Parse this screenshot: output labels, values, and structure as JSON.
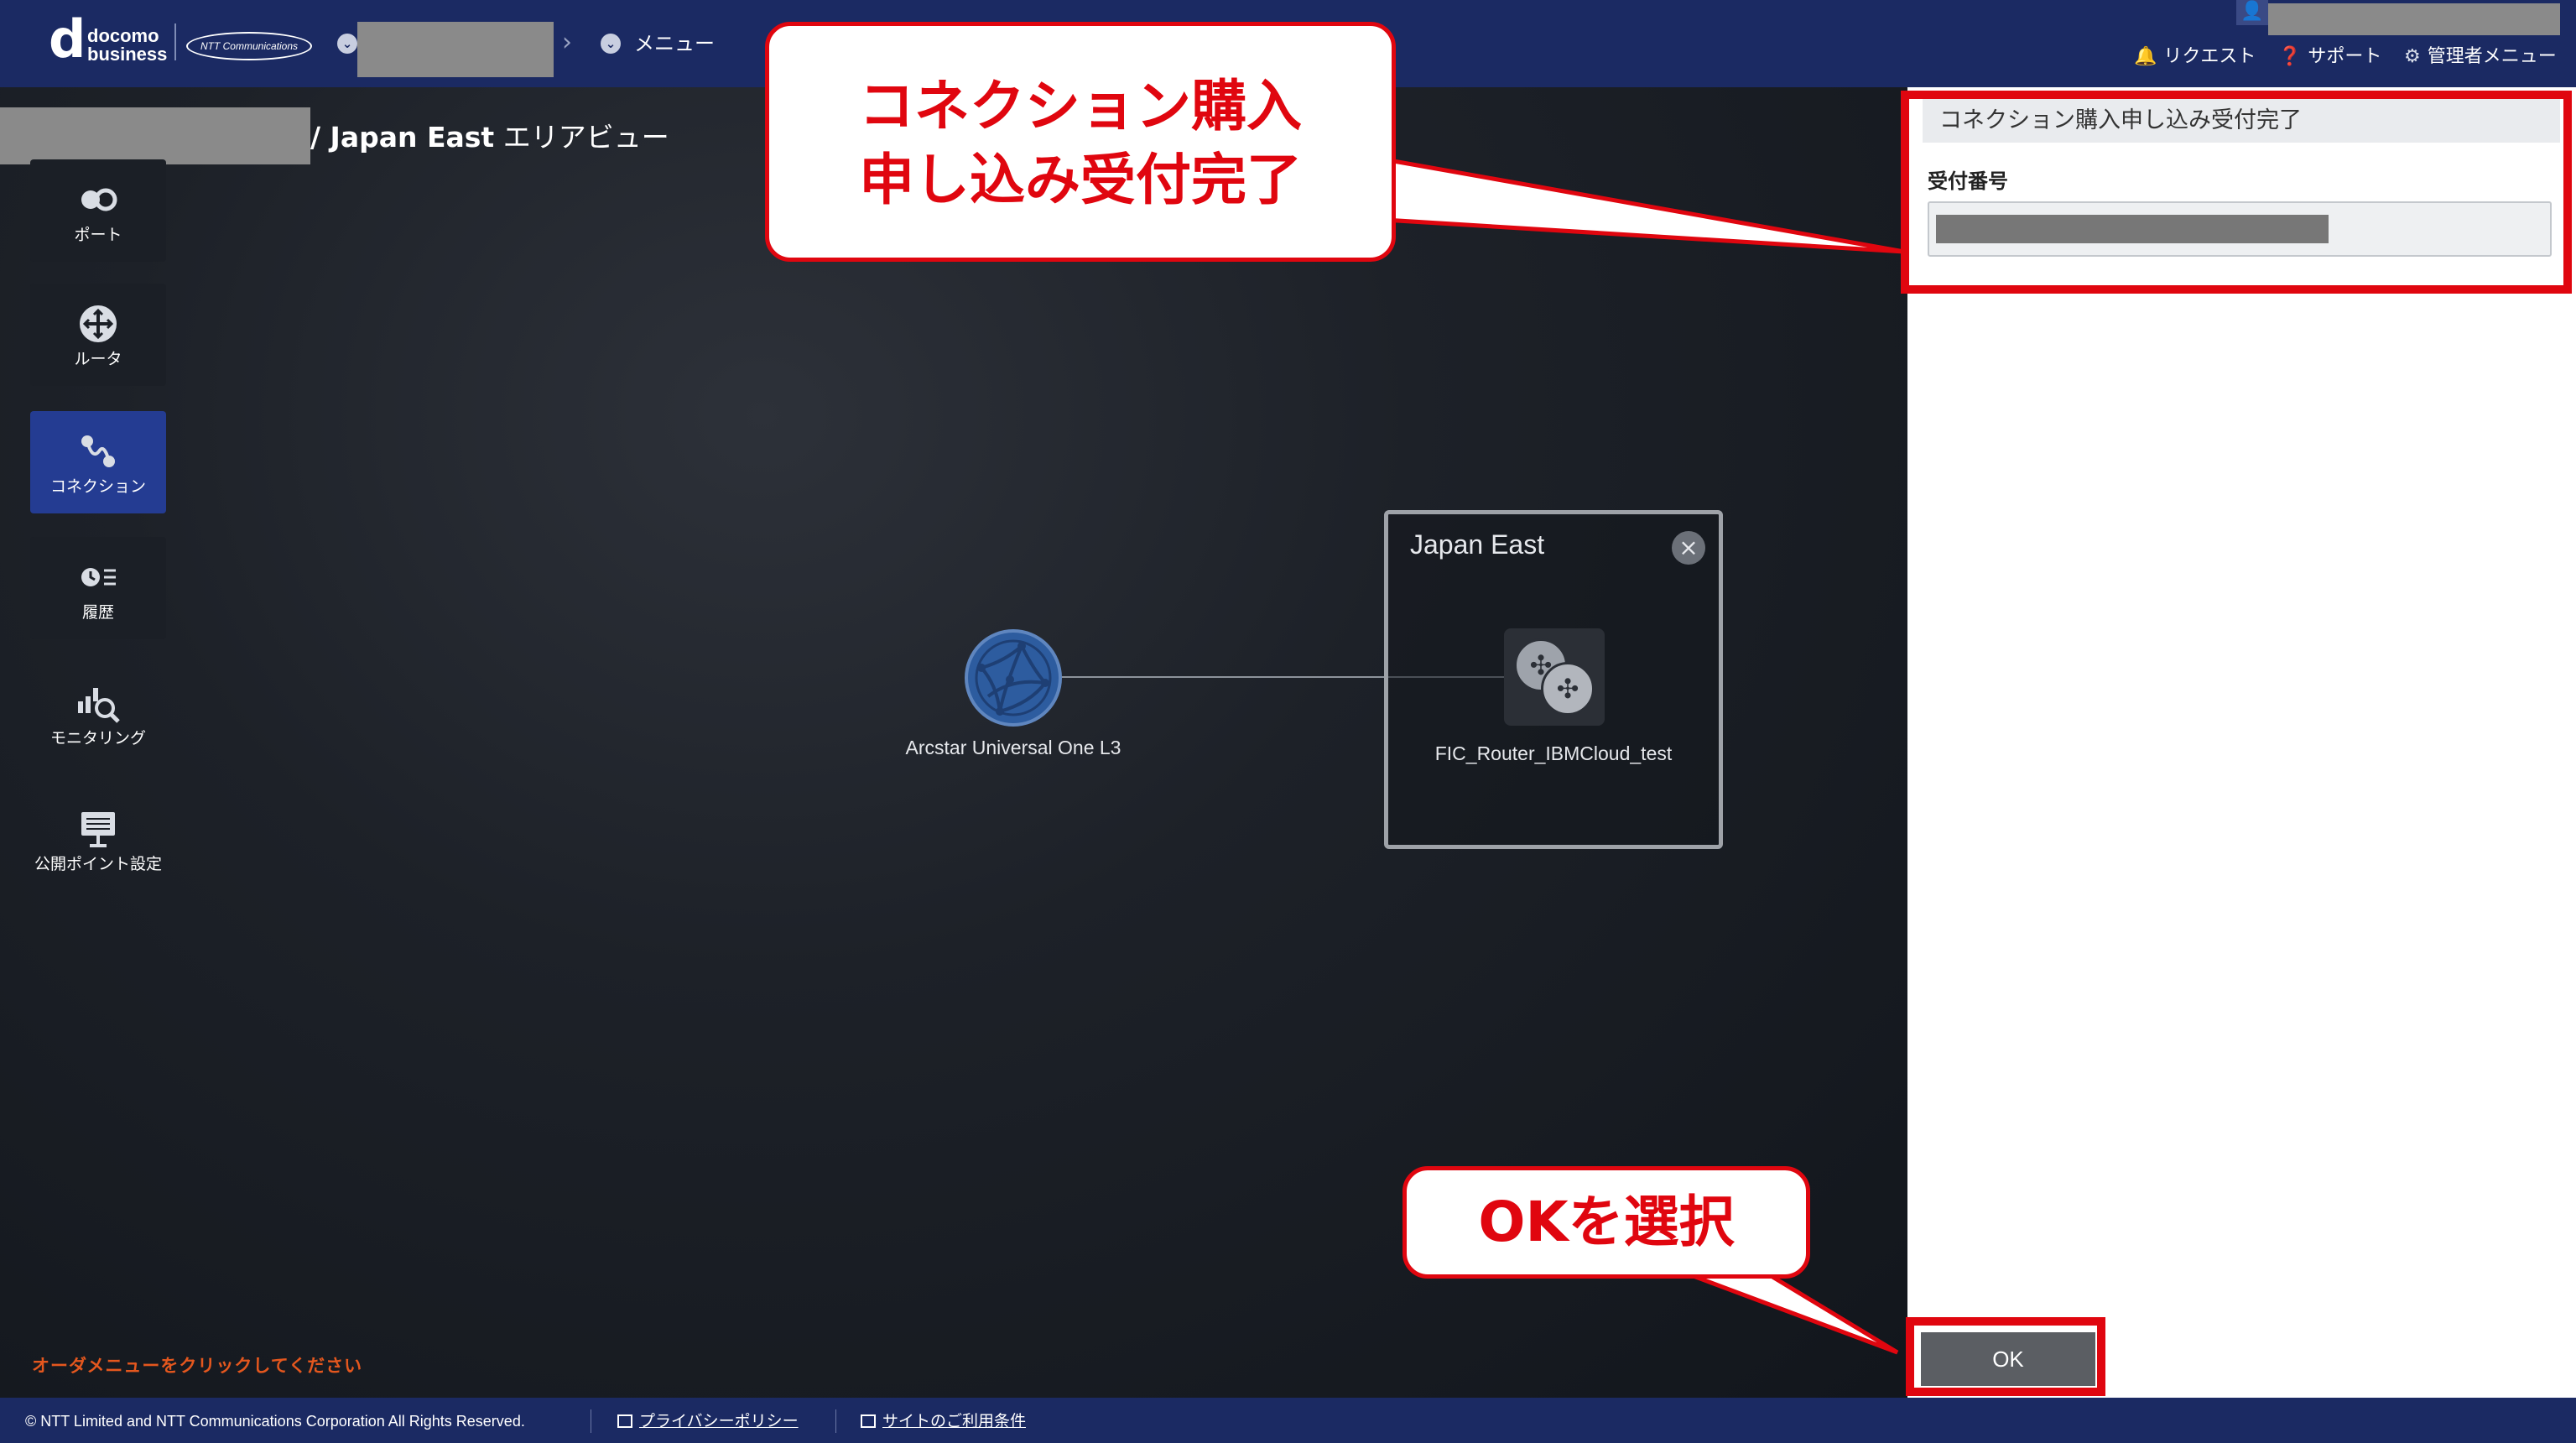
{
  "header": {
    "logo": {
      "mark": "d",
      "line1": "docomo",
      "line2": "business",
      "partner": "NTT Communications"
    },
    "breadcrumb": {
      "menu_label": "メニュー"
    },
    "links": {
      "request": "リクエスト",
      "support": "サポート",
      "admin_menu": "管理者メニュー"
    },
    "icons": [
      "bell-icon",
      "help-icon",
      "gear-icon",
      "user-icon"
    ]
  },
  "page": {
    "heading_bold": "/ Japan East",
    "heading_rest": " エリアビュー"
  },
  "sidebar": {
    "items": [
      {
        "label": "ポート",
        "icon": "port-icon",
        "active": false
      },
      {
        "label": "ルータ",
        "icon": "router-icon",
        "active": false
      },
      {
        "label": "コネクション",
        "icon": "connection-icon",
        "active": true
      },
      {
        "label": "履歴",
        "icon": "history-icon",
        "active": false
      },
      {
        "label": "モニタリング",
        "icon": "monitoring-icon",
        "active": false
      },
      {
        "label": "公開ポイント設定",
        "icon": "public-point-icon",
        "active": false
      }
    ]
  },
  "canvas": {
    "order_hint": "オーダメニューをクリックしてください",
    "arcstar_label": "Arcstar Universal One L3",
    "region_title": "Japan East",
    "router_label": "FIC_Router_IBMCloud_test"
  },
  "panel": {
    "title": "コネクション購入申し込み受付完了",
    "receipt_label": "受付番号",
    "ok_label": "OK"
  },
  "callouts": {
    "completion_line1": "コネクション購入",
    "completion_line2": "申し込み受付完了",
    "select_ok": "OKを選択"
  },
  "footer": {
    "copyright": "© NTT Limited and NTT Communications Corporation All Rights Reserved.",
    "privacy": "プライバシーポリシー",
    "terms": "サイトのご利用条件"
  },
  "colors": {
    "header": "#1b2a63",
    "active_item": "#243c92",
    "highlight": "#e0060f",
    "hint": "#e4571e"
  }
}
